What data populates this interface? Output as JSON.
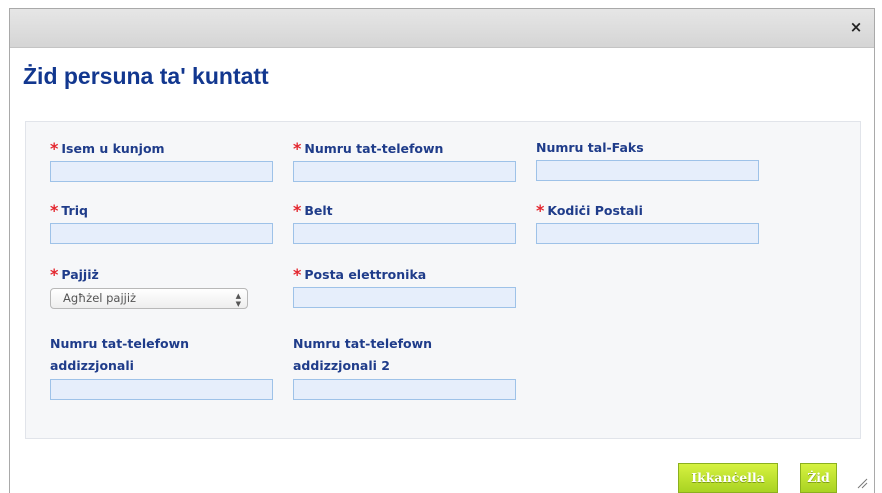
{
  "dialog": {
    "close_symbol": "×",
    "title": "Żid persuna ta' kuntatt"
  },
  "form": {
    "required_mark": "*",
    "name_label": "Isem u kunjom",
    "phone_label": "Numru tat-telefown",
    "fax_label": "Numru tal-Faks",
    "street_label": "Triq",
    "city_label": "Belt",
    "postal_label": "Kodiċi Postali",
    "country_label": "Pajjiż",
    "country_select_value": "Agħżel pajjiż",
    "email_label": "Posta elettronika",
    "addphone1_label_line1": "Numru tat-telefown",
    "addphone1_label_line2": "addizzjonali",
    "addphone2_label_line1": "Numru tat-telefown",
    "addphone2_label_line2": "addizzjonali 2"
  },
  "buttons": {
    "cancel": "Ikkanċella",
    "add": "Żid"
  },
  "icons": {
    "close": "close-icon",
    "select_arrow": "select-arrows-icon",
    "resize": "resize-grip-icon"
  },
  "colors": {
    "title": "#12378f",
    "label": "#1f3c8a",
    "required": "#e3262e",
    "input_bg": "#e6eefb",
    "button": "#b9df2b"
  }
}
